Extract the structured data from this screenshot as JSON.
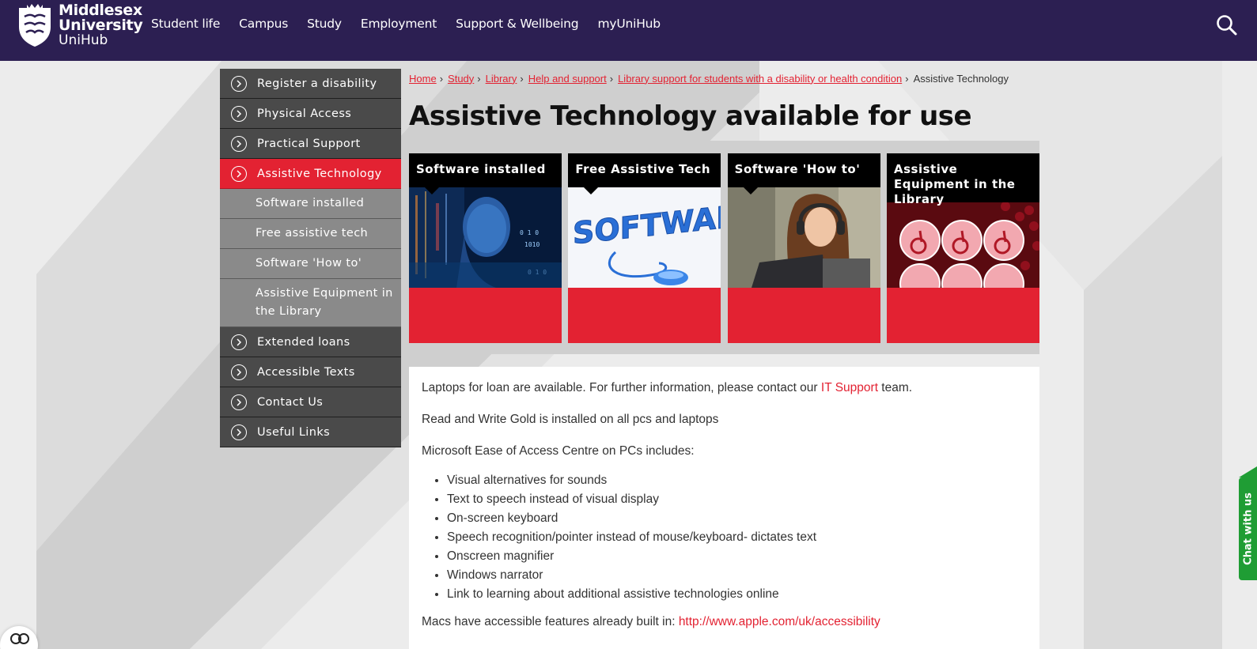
{
  "header": {
    "logo_line1": "Middlesex",
    "logo_line2": "University",
    "logo_line3": "UniHub",
    "nav": [
      "Student life",
      "Campus",
      "Study",
      "Employment",
      "Support & Wellbeing",
      "myUniHub"
    ],
    "search_icon": "search-icon",
    "bg_color": "#2c1f52"
  },
  "sidebar": {
    "top_items": [
      "Register a disability",
      "Physical Access",
      "Practical Support"
    ],
    "active_item": "Assistive Technology",
    "sub_items": [
      "Software installed",
      "Free assistive tech",
      "Software 'How to'",
      "Assistive Equipment in the Library"
    ],
    "bottom_items": [
      "Extended loans",
      "Accessible Texts",
      "Contact Us",
      "Useful Links"
    ],
    "accent": "#e32232"
  },
  "breadcrumb": {
    "links": [
      "Home",
      "Study",
      "Library",
      "Help and support",
      "Library support for students with a disability or health condition"
    ],
    "current": "Assistive Technology"
  },
  "page_title": "Assistive Technology available for use",
  "tiles": [
    {
      "title": "Software installed"
    },
    {
      "title": "Free Assistive Tech"
    },
    {
      "title": "Software 'How to'"
    },
    {
      "title": "Assistive Equipment in the Library"
    }
  ],
  "content": {
    "p1_before": "Laptops for loan are available. For further information, please contact our ",
    "p1_link": "IT Support",
    "p1_after": " team.",
    "p2": "Read and Write Gold is installed on all pcs and laptops",
    "p3": "Microsoft Ease of Access Centre on PCs includes:",
    "list": [
      "Visual alternatives for sounds",
      "Text to speech instead of visual display",
      "On-screen keyboard",
      "Speech recognition/pointer instead of mouse/keyboard- dictates text",
      "Onscreen magnifier",
      "Windows narrator",
      "Link to learning about additional assistive technologies online"
    ],
    "p4_before": "Macs have accessible features already built in: ",
    "p4_link": "http://www.apple.com/uk/accessibility"
  },
  "chat": {
    "label": "Chat with us",
    "color": "#1f9d34"
  }
}
